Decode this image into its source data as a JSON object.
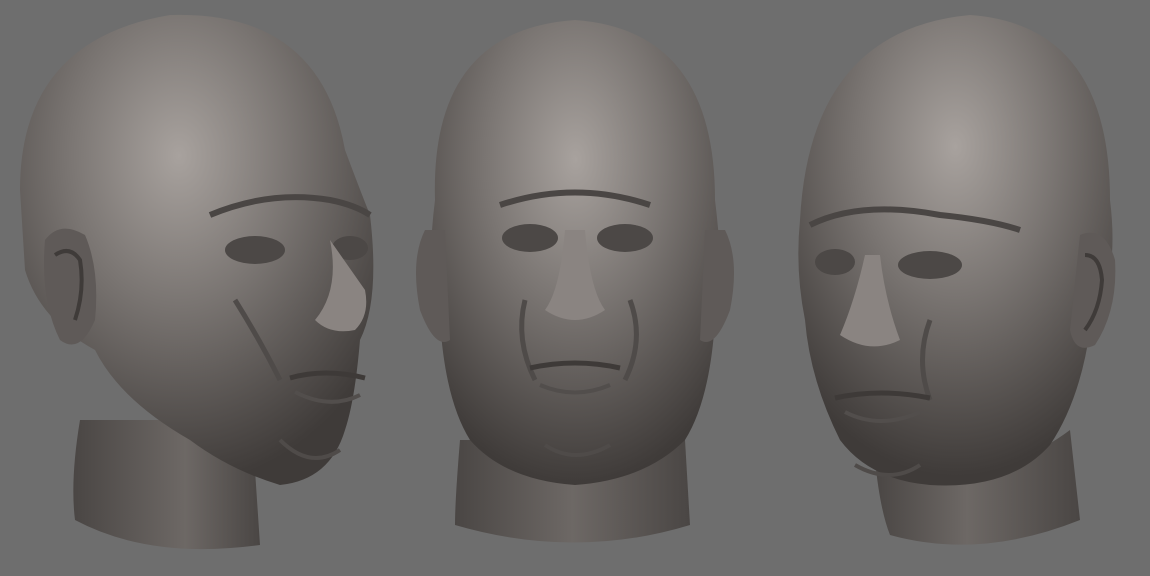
{
  "image": {
    "background_color": "#6e6e6e",
    "clay_color": "#75706d",
    "clay_highlight": "#a8a29e",
    "clay_shadow": "#3f3b39",
    "views": [
      {
        "id": "three-quarter-left",
        "kind": "sculpt-render"
      },
      {
        "id": "front",
        "kind": "sculpt-render"
      },
      {
        "id": "three-quarter-right",
        "kind": "sculpt-render"
      }
    ]
  }
}
